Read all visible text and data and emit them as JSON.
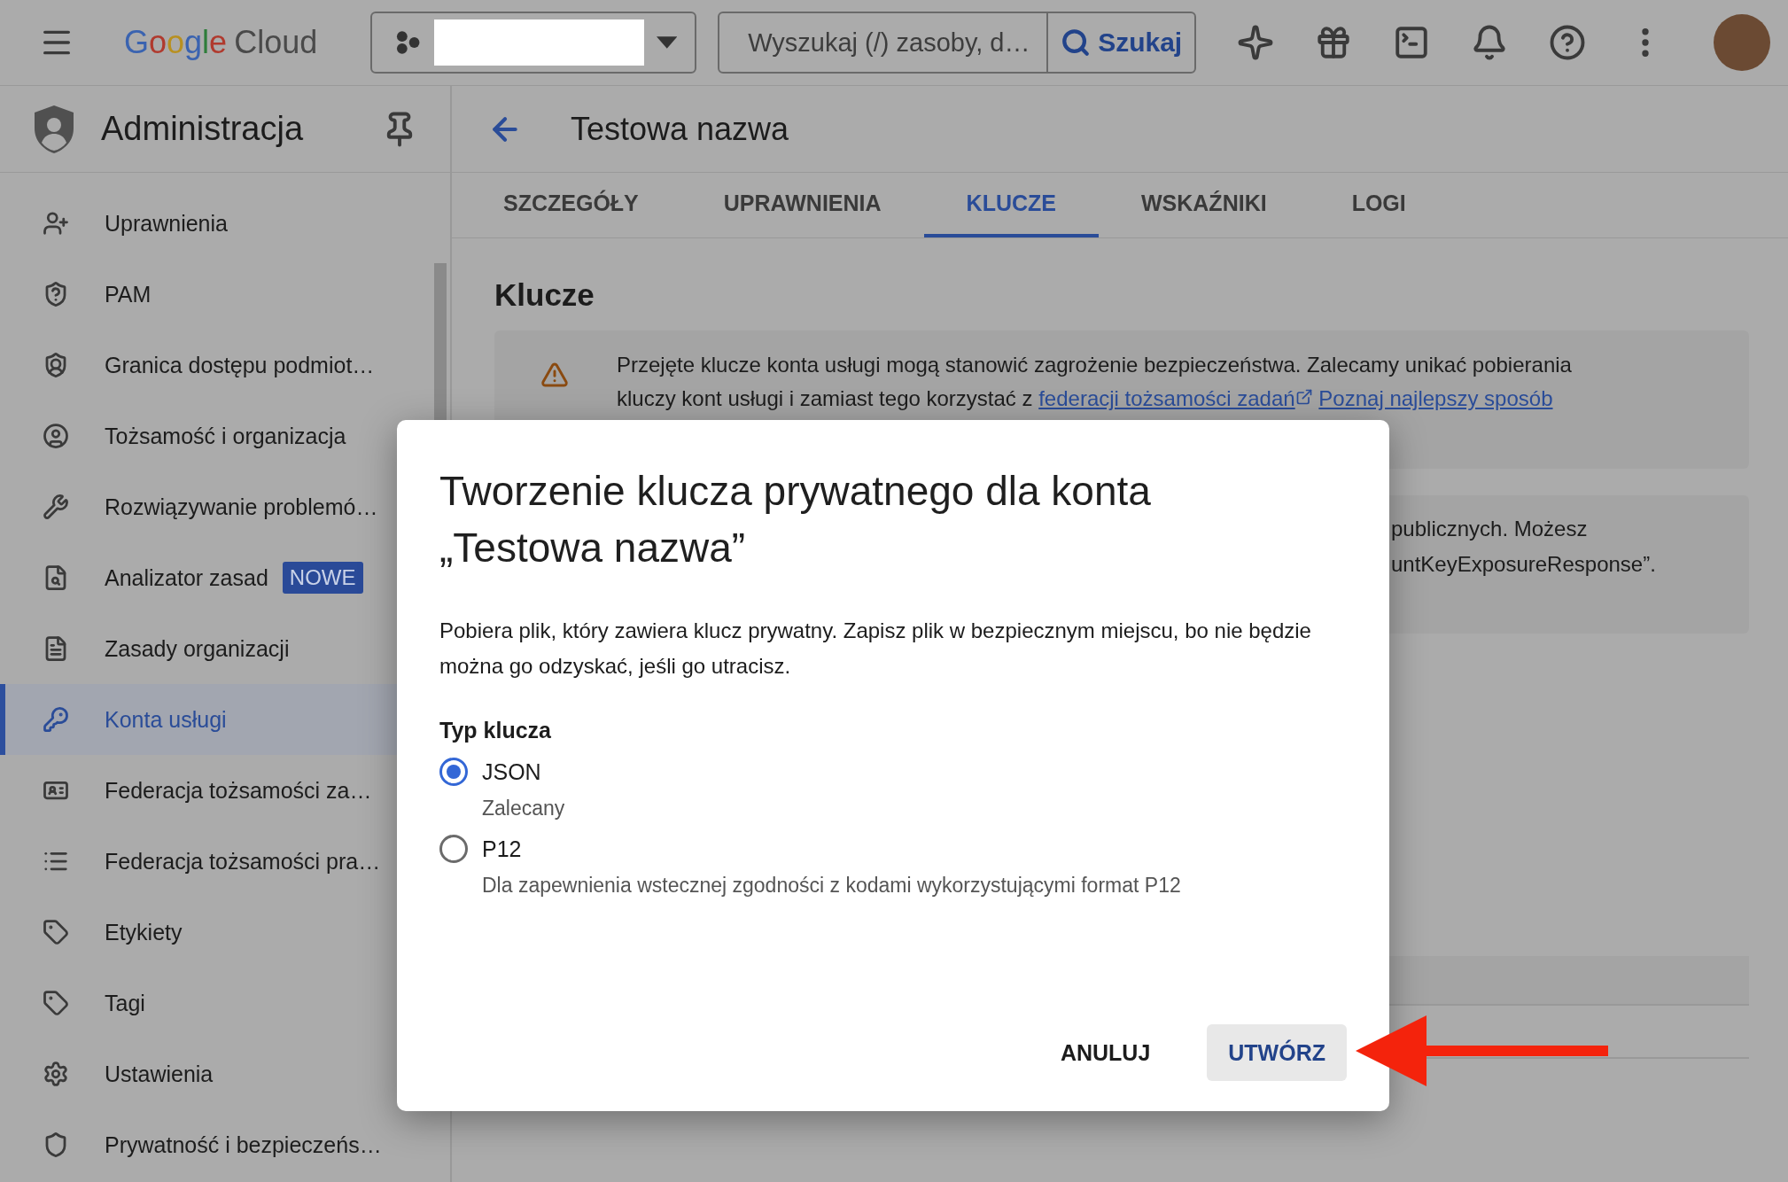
{
  "topbar": {
    "logo": {
      "brand": "Google",
      "product": "Cloud"
    },
    "search": {
      "placeholder": "Wyszukaj (/) zasoby, d…",
      "button": "Szukaj"
    }
  },
  "sidebar": {
    "title": "Administracja",
    "items": [
      {
        "label": "Uprawnienia",
        "selected": false
      },
      {
        "label": "PAM",
        "selected": false
      },
      {
        "label": "Granica dostępu podmiot…",
        "selected": false
      },
      {
        "label": "Tożsamość i organizacja",
        "selected": false
      },
      {
        "label": "Rozwiązywanie problemó…",
        "selected": false
      },
      {
        "label": "Analizator zasad",
        "badge": "NOWE",
        "selected": false
      },
      {
        "label": "Zasady organizacji",
        "selected": false
      },
      {
        "label": "Konta usługi",
        "selected": true
      },
      {
        "label": "Federacja tożsamości za…",
        "selected": false
      },
      {
        "label": "Federacja tożsamości pra…",
        "selected": false
      },
      {
        "label": "Etykiety",
        "selected": false
      },
      {
        "label": "Tagi",
        "selected": false
      },
      {
        "label": "Ustawienia",
        "selected": false
      },
      {
        "label": "Prywatność i bezpieczeńs…",
        "selected": false
      }
    ]
  },
  "page": {
    "title": "Testowa nazwa",
    "tabs": [
      {
        "label": "SZCZEGÓŁY",
        "selected": false
      },
      {
        "label": "UPRAWNIENIA",
        "selected": false
      },
      {
        "label": "KLUCZE",
        "selected": true
      },
      {
        "label": "WSKAŹNIKI",
        "selected": false
      },
      {
        "label": "LOGI",
        "selected": false
      }
    ],
    "section_title": "Klucze",
    "warning": {
      "line_1": "Przejęte klucze konta usługi mogą stanowić zagrożenie bezpieczeństwa. Zalecamy unikać pobierania",
      "line_2": "kluczy kont usługi i zamiast tego korzystać z",
      "link_1": "federacji tożsamości zadań",
      "link_2": "Poznaj najlepszy sposób"
    },
    "notice": {
      "line_1": "publicznych. Możesz",
      "line_2": "untKeyExposureResponse”."
    }
  },
  "dialog": {
    "title": "Tworzenie klucza prywatnego dla konta „Testowa nazwa”",
    "body": "Pobiera plik, który zawiera klucz prywatny. Zapisz plik w bezpiecznym miejscu, bo nie będzie można go odzyskać, jeśli go utracisz.",
    "group_label": "Typ klucza",
    "options": [
      {
        "label": "JSON",
        "hint": "Zalecany",
        "selected": true
      },
      {
        "label": "P12",
        "hint": "Dla zapewnienia wstecznej zgodności z kodami wykorzystującymi format P12",
        "selected": false
      }
    ],
    "buttons": {
      "cancel": "ANULUJ",
      "confirm": "UTWÓRZ"
    }
  }
}
